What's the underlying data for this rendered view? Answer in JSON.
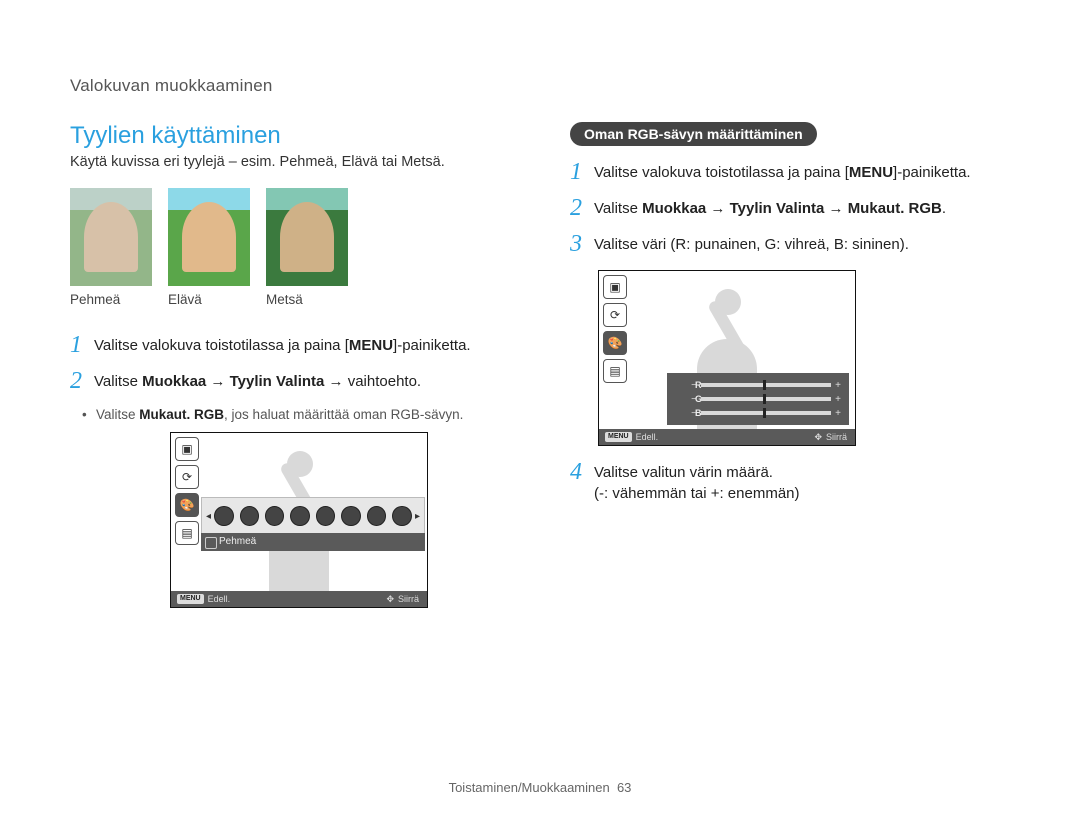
{
  "header": "Valokuvan muokkaaminen",
  "left": {
    "title": "Tyylien käyttäminen",
    "intro": "Käytä kuvissa eri tyylejä – esim. Pehmeä, Elävä tai Metsä.",
    "thumbs": [
      "Pehmeä",
      "Elävä",
      "Metsä"
    ],
    "step1_pre": "Valitse valokuva toistotilassa ja paina [",
    "step1_key": "MENU",
    "step1_post": "]-painiketta.",
    "step2_pre": "Valitse ",
    "step2_bold": "Muokkaa → Tyylin Valinta",
    "step2_post": " → vaihtoehto.",
    "bullet_pre": "Valitse ",
    "bullet_bold": "Mukaut. RGB",
    "bullet_post": ", jos haluat määrittää oman RGB-sävyn.",
    "ui_style_label": "Pehmeä",
    "ui_menu_chip": "MENU",
    "ui_edell": "Edell.",
    "ui_siirra": "Siirrä"
  },
  "right": {
    "pill": "Oman RGB-sävyn määrittäminen",
    "step1_pre": "Valitse valokuva toistotilassa ja paina [",
    "step1_key": "MENU",
    "step1_post": "]-painiketta.",
    "step2_pre": "Valitse ",
    "step2_bold": "Muokkaa → Tyylin Valinta → Mukaut. RGB",
    "step2_post": ".",
    "step3": "Valitse väri (R: punainen, G: vihreä, B: sininen).",
    "step4_a": "Valitse valitun värin määrä.",
    "step4_b": "(-: vähemmän tai +: enemmän)",
    "rgb": [
      "R",
      "G",
      "B"
    ],
    "ui_menu_chip": "MENU",
    "ui_edell": "Edell.",
    "ui_siirra": "Siirrä"
  },
  "footer": {
    "section": "Toistaminen/Muokkaaminen",
    "page": "63"
  }
}
